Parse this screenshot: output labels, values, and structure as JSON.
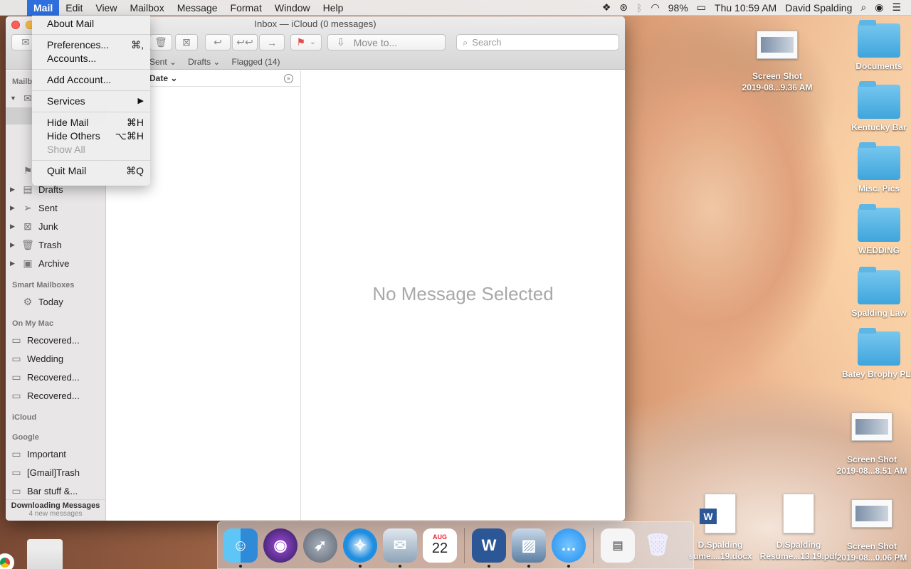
{
  "menubar": {
    "apple": "",
    "items": [
      "Mail",
      "Edit",
      "View",
      "Mailbox",
      "Message",
      "Format",
      "Window",
      "Help"
    ],
    "right": {
      "battery": "98%",
      "clock": "Thu 10:59 AM",
      "user": "David Spalding"
    }
  },
  "mail_menu": {
    "items": [
      {
        "label": "About Mail",
        "shortcut": ""
      },
      {
        "label": "Preferences...",
        "shortcut": "⌘,"
      },
      {
        "label": "Accounts...",
        "shortcut": ""
      },
      {
        "label": "Add Account...",
        "shortcut": ""
      },
      {
        "label": "Services",
        "shortcut": "▶"
      },
      {
        "label": "Hide Mail",
        "shortcut": "⌘H"
      },
      {
        "label": "Hide Others",
        "shortcut": "⌥⌘H"
      },
      {
        "label": "Show All",
        "shortcut": ""
      },
      {
        "label": "Quit Mail",
        "shortcut": "⌘Q"
      }
    ]
  },
  "window": {
    "title": "Inbox — iCloud (0 messages)",
    "move_to": "Move to...",
    "search_placeholder": "Search",
    "favorites": [
      "Sent ⌄",
      "Drafts ⌄",
      "Flagged (14)"
    ],
    "sort_label": "Date ⌄",
    "empty_text": "No Message Selected"
  },
  "sidebar": {
    "mailboxes_head": "Mailb",
    "mail_items": [
      "Drafts",
      "Sent",
      "Junk",
      "Trash",
      "Archive"
    ],
    "smart_head": "Smart Mailboxes",
    "smart_items": [
      "Today"
    ],
    "onmac_head": "On My Mac",
    "onmac_items": [
      "Recovered...",
      "Wedding",
      "Recovered...",
      "Recovered..."
    ],
    "icloud_head": "iCloud",
    "google_head": "Google",
    "google_items": [
      "Important",
      "[Gmail]Trash",
      "Bar stuff &..."
    ],
    "footer_title": "Downloading Messages",
    "footer_sub": "4 new messages"
  },
  "desktop": {
    "right_column": [
      "Documents",
      "Kentucky Bar",
      "Misc. Pics",
      "WEDDING",
      "Spalding Law",
      "Batey Brophy PLL"
    ],
    "shot1": [
      "Screen Shot",
      "2019-08...9.36 AM"
    ],
    "shot2": [
      "Screen Shot",
      "2019-08...8.51 AM"
    ],
    "shot3": [
      "Screen Shot",
      "2019-08...0.06 PM"
    ],
    "doc1": [
      "D.Spalding",
      "sume....19.docx"
    ],
    "doc2": [
      "D.Spalding",
      "Resume...13.19.pdf"
    ]
  },
  "dock": {
    "apps": [
      "finder-icon",
      "siri-icon",
      "launchpad-icon",
      "safari-icon",
      "mail-icon",
      "calendar-icon",
      "word-icon",
      "preview-icon",
      "messages-icon"
    ],
    "calendar_month": "AUG",
    "calendar_day": "22"
  },
  "colors": {
    "accent": "#2e6fdd",
    "folder": "#4fb0e3"
  }
}
